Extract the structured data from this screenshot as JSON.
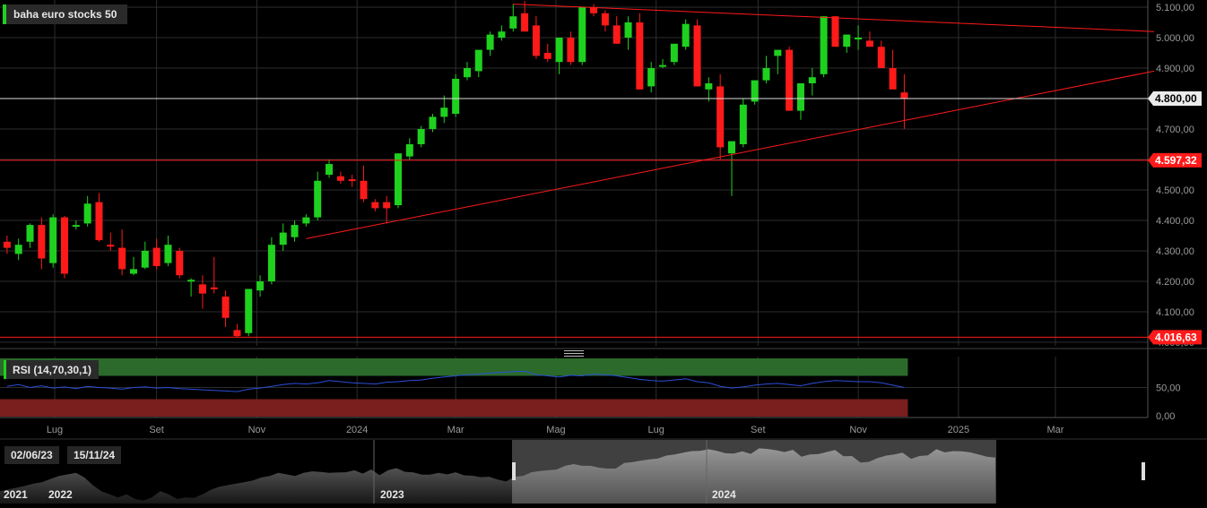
{
  "title": "baha euro stocks 50",
  "indicator": {
    "label": "RSI (14,70,30,1)",
    "ticks": [
      "50,00",
      "0,00"
    ]
  },
  "range": {
    "start": "02/06/23",
    "end": "15/11/24"
  },
  "navigator_years": [
    "2021",
    "2022",
    "2023",
    "2024"
  ],
  "colors": {
    "up": "#1fd11f",
    "down": "#ff1a1a",
    "line": "#ff1a1a",
    "rsi": "#2b4ed8",
    "overbought": "#2b6a2b",
    "oversold": "#7a1e1e"
  },
  "price_labels": {
    "current": "4.800,00",
    "level_high": "4.597,32",
    "level_low": "4.016,63"
  },
  "chart_data": {
    "type": "candlestick",
    "title": "baha euro stocks 50",
    "ylim": [
      4000,
      5120
    ],
    "y_ticks": [
      "5.100,00",
      "5.000,00",
      "4.900,00",
      "4.800,00",
      "4.700,00",
      "4.600,00",
      "4.500,00",
      "4.400,00",
      "4.300,00",
      "4.200,00",
      "4.100,00",
      "4.000,00"
    ],
    "y_tick_values": [
      5100,
      5000,
      4900,
      4800,
      4700,
      4600,
      4500,
      4400,
      4300,
      4200,
      4100,
      4000
    ],
    "x_ticks": [
      "Lug",
      "Set",
      "Nov",
      "2024",
      "Mar",
      "Mag",
      "Lug",
      "Set",
      "Nov",
      "2025",
      "Mar"
    ],
    "x_tick_dates": [
      "2023-07-01",
      "2023-09-01",
      "2023-11-01",
      "2024-01-01",
      "2024-03-01",
      "2024-05-01",
      "2024-07-01",
      "2024-09-01",
      "2024-11-01",
      "2025-01-01",
      "2025-03-01"
    ],
    "first_week": "2023-06-02",
    "week_step_days": 7,
    "candles": [
      [
        4330,
        4350,
        4290,
        4310
      ],
      [
        4290,
        4340,
        4270,
        4320
      ],
      [
        4330,
        4390,
        4310,
        4385
      ],
      [
        4385,
        4410,
        4240,
        4275
      ],
      [
        4260,
        4420,
        4245,
        4410
      ],
      [
        4410,
        4415,
        4210,
        4225
      ],
      [
        4380,
        4400,
        4370,
        4385
      ],
      [
        4390,
        4480,
        4380,
        4455
      ],
      [
        4460,
        4490,
        4330,
        4335
      ],
      [
        4320,
        4360,
        4300,
        4315
      ],
      [
        4310,
        4370,
        4220,
        4240
      ],
      [
        4225,
        4280,
        4220,
        4240
      ],
      [
        4245,
        4330,
        4240,
        4300
      ],
      [
        4310,
        4340,
        4240,
        4250
      ],
      [
        4260,
        4350,
        4250,
        4320
      ],
      [
        4300,
        4310,
        4210,
        4220
      ],
      [
        4200,
        4210,
        4150,
        4205
      ],
      [
        4190,
        4220,
        4110,
        4160
      ],
      [
        4180,
        4280,
        4160,
        4175
      ],
      [
        4150,
        4170,
        4050,
        4080
      ],
      [
        4040,
        4060,
        4015,
        4020
      ],
      [
        4030,
        4170,
        4020,
        4175
      ],
      [
        4170,
        4220,
        4150,
        4200
      ],
      [
        4200,
        4345,
        4190,
        4320
      ],
      [
        4320,
        4390,
        4300,
        4360
      ],
      [
        4345,
        4400,
        4330,
        4385
      ],
      [
        4390,
        4420,
        4380,
        4410
      ],
      [
        4410,
        4560,
        4400,
        4530
      ],
      [
        4550,
        4600,
        4540,
        4585
      ],
      [
        4545,
        4560,
        4520,
        4530
      ],
      [
        4535,
        4550,
        4510,
        4530
      ],
      [
        4530,
        4580,
        4460,
        4470
      ],
      [
        4460,
        4470,
        4430,
        4440
      ],
      [
        4460,
        4480,
        4390,
        4440
      ],
      [
        4450,
        4620,
        4440,
        4620
      ],
      [
        4610,
        4670,
        4600,
        4650
      ],
      [
        4650,
        4710,
        4640,
        4700
      ],
      [
        4700,
        4750,
        4690,
        4740
      ],
      [
        4740,
        4810,
        4720,
        4770
      ],
      [
        4750,
        4880,
        4740,
        4865
      ],
      [
        4870,
        4920,
        4860,
        4900
      ],
      [
        4890,
        4940,
        4870,
        4960
      ],
      [
        4960,
        5020,
        4940,
        5010
      ],
      [
        5000,
        5040,
        4990,
        5020
      ],
      [
        5030,
        5110,
        5020,
        5070
      ],
      [
        5080,
        5120,
        5020,
        5020
      ],
      [
        5040,
        5070,
        4930,
        4940
      ],
      [
        4950,
        4980,
        4920,
        4930
      ],
      [
        4920,
        5000,
        4880,
        5000
      ],
      [
        5000,
        5020,
        4910,
        4920
      ],
      [
        4920,
        5100,
        4910,
        5100
      ],
      [
        5100,
        5110,
        5070,
        5080
      ],
      [
        5080,
        5090,
        5020,
        5040
      ],
      [
        5040,
        5070,
        4980,
        4980
      ],
      [
        5000,
        5070,
        4960,
        5050
      ],
      [
        5050,
        5080,
        4830,
        4830
      ],
      [
        4840,
        4920,
        4820,
        4900
      ],
      [
        4910,
        4930,
        4900,
        4910
      ],
      [
        4920,
        4960,
        4910,
        4980
      ],
      [
        4970,
        5060,
        4960,
        5045
      ],
      [
        5040,
        5060,
        4840,
        4840
      ],
      [
        4830,
        4870,
        4790,
        4850
      ],
      [
        4840,
        4880,
        4600,
        4640
      ],
      [
        4620,
        4650,
        4480,
        4660
      ],
      [
        4650,
        4800,
        4640,
        4780
      ],
      [
        4790,
        4840,
        4780,
        4860
      ],
      [
        4860,
        4940,
        4850,
        4900
      ],
      [
        4940,
        4950,
        4880,
        4960
      ],
      [
        4960,
        4970,
        4760,
        4760
      ],
      [
        4760,
        4780,
        4730,
        4850
      ],
      [
        4850,
        4900,
        4810,
        4870
      ],
      [
        4880,
        5070,
        4870,
        5070
      ],
      [
        5070,
        5070,
        4970,
        4970
      ],
      [
        4970,
        5010,
        4950,
        5010
      ],
      [
        5000,
        5040,
        4960,
        5000
      ],
      [
        4990,
        5020,
        4970,
        4970
      ],
      [
        4970,
        4990,
        4900,
        4900
      ],
      [
        4900,
        4960,
        4860,
        4830
      ],
      [
        4820,
        4880,
        4700,
        4800
      ]
    ],
    "resistance_line": {
      "from": [
        "2024-04-05",
        5110
      ],
      "to": [
        "2025-04-30",
        5020
      ]
    },
    "support_line": {
      "from": [
        "2023-12-01",
        4340
      ],
      "to": [
        "2025-04-30",
        4890
      ]
    },
    "levels": [
      4800,
      4597.32,
      4016.63
    ],
    "rsi": {
      "ylim": [
        0,
        100
      ],
      "overbought": 70,
      "oversold": 30,
      "values": [
        52,
        55,
        50,
        53,
        49,
        51,
        48,
        52,
        50,
        49,
        47,
        50,
        51,
        49,
        50,
        48,
        47,
        46,
        45,
        44,
        43,
        47,
        49,
        52,
        55,
        57,
        56,
        58,
        62,
        60,
        58,
        57,
        56,
        59,
        60,
        62,
        63,
        66,
        68,
        70,
        72,
        73,
        75,
        76,
        77,
        78,
        72,
        70,
        68,
        71,
        70,
        73,
        72,
        70,
        67,
        64,
        62,
        61,
        63,
        65,
        60,
        58,
        52,
        49,
        51,
        54,
        56,
        57,
        55,
        53,
        57,
        60,
        62,
        61,
        60,
        60,
        58,
        54,
        50
      ]
    }
  }
}
